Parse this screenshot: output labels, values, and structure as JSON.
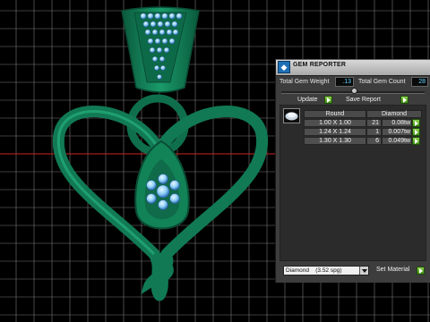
{
  "panel": {
    "title": "GEM REPORTER",
    "total_weight_label": "Total Gem Weight",
    "total_weight_value": ".13",
    "total_count_label": "Total Gem Count",
    "total_count_value": "28",
    "update_label": "Update",
    "save_report_label": "Save Report",
    "table": {
      "col_shape": "Round",
      "col_material": "Diamond",
      "rows": [
        {
          "size": "1.00 X 1.00",
          "count": "21",
          "weight": "0.08tw"
        },
        {
          "size": "1.24 X 1.24",
          "count": "1",
          "weight": "0.007tw"
        },
        {
          "size": "1.30 X 1.30",
          "count": "6",
          "weight": "0.049tw"
        }
      ]
    },
    "material_select": "Diamond    (3.52 spg)",
    "set_material_label": "Set Material"
  },
  "colors": {
    "model": "#117a55",
    "model_dark": "#0a4d35",
    "grid": "#8a8a8a",
    "value_text": "#5fd6ff",
    "go_button": "#5aaa2a"
  }
}
